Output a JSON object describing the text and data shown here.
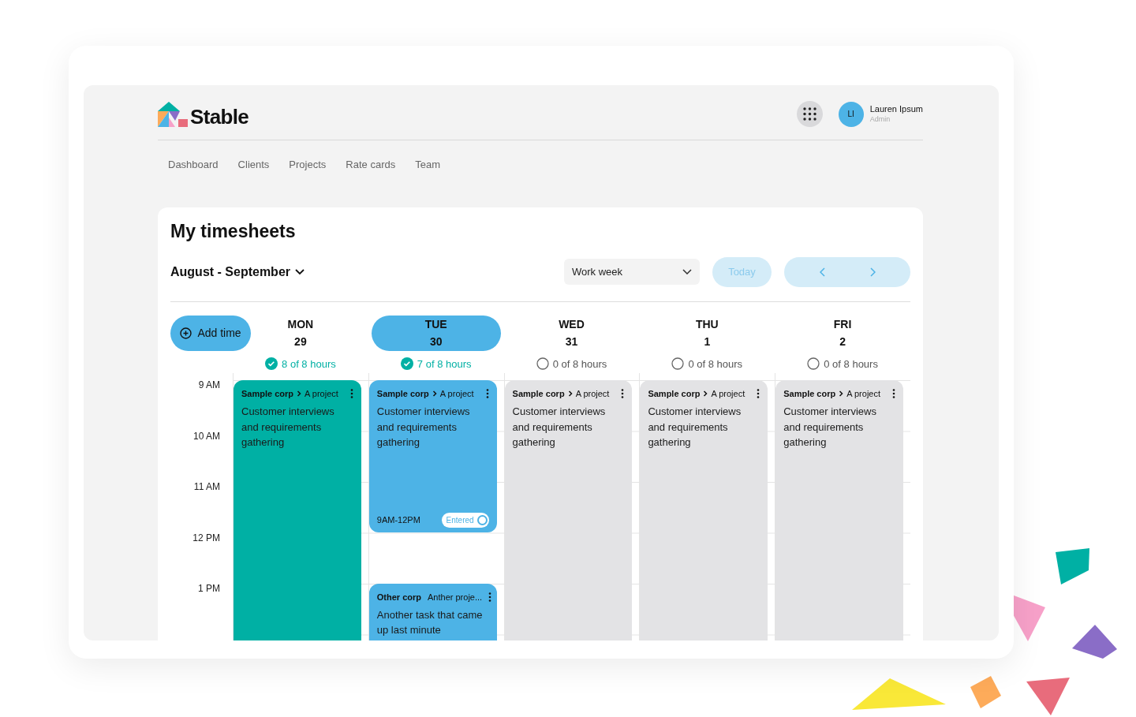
{
  "brand": {
    "name": "Stable"
  },
  "user": {
    "initials": "LI",
    "name": "Lauren Ipsum",
    "role": "Admin"
  },
  "nav": [
    "Dashboard",
    "Clients",
    "Projects",
    "Rate cards",
    "Team"
  ],
  "page": {
    "title": "My timesheets",
    "period": "August - September",
    "view": "Work week",
    "today_button": "Today",
    "add_button": "Add time"
  },
  "time_labels": [
    "9 AM",
    "10 AM",
    "11 AM",
    "12 PM",
    "1 PM"
  ],
  "days": [
    {
      "weekday": "MON",
      "date": "29",
      "hours": "8 of 8 hours",
      "complete": true,
      "selected": false,
      "entries": [
        {
          "kind": "open",
          "color": "#00b0a4",
          "client": "Sample corp",
          "project": "A project",
          "title": "Customer interviews and requirements gathering"
        }
      ]
    },
    {
      "weekday": "TUE",
      "date": "30",
      "hours": "7 of 8 hours",
      "complete": true,
      "selected": true,
      "entries": [
        {
          "kind": "block",
          "color": "#4db3e6",
          "client": "Sample corp",
          "project": "A project",
          "title": "Customer interviews and requirements gathering",
          "time": "9AM-12PM",
          "badge": "Entered"
        },
        {
          "kind": "open",
          "color": "#4db3e6",
          "client": "Other corp",
          "project": "Anther proje...",
          "title": "Another task that came up last minute"
        }
      ]
    },
    {
      "weekday": "WED",
      "date": "31",
      "hours": "0 of 8 hours",
      "complete": false,
      "selected": false,
      "entries": [
        {
          "kind": "open",
          "color": "#e3e3e5",
          "client": "Sample corp",
          "project": "A project",
          "title": "Customer interviews and requirements gathering"
        }
      ]
    },
    {
      "weekday": "THU",
      "date": "1",
      "hours": "0 of 8 hours",
      "complete": false,
      "selected": false,
      "entries": [
        {
          "kind": "open",
          "color": "#e3e3e5",
          "client": "Sample corp",
          "project": "A project",
          "title": "Customer interviews and requirements gathering"
        }
      ]
    },
    {
      "weekday": "FRI",
      "date": "2",
      "hours": "0 of 8 hours",
      "complete": false,
      "selected": false,
      "entries": [
        {
          "kind": "open",
          "color": "#e3e3e5",
          "client": "Sample corp",
          "project": "A project",
          "title": "Customer interviews and requirements gathering"
        }
      ]
    }
  ]
}
